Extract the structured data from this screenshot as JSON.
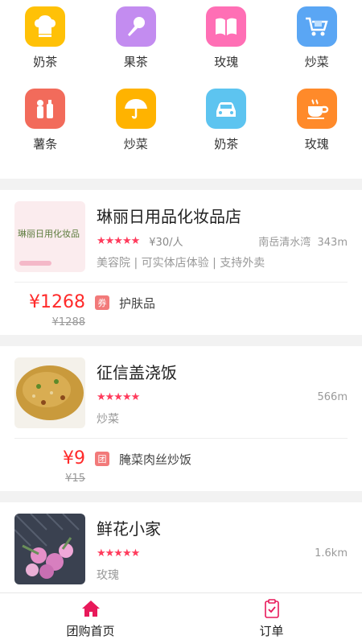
{
  "colors": {
    "accent": "#e8195a",
    "price": "#ff2a2a",
    "star": "#ff3b5c"
  },
  "categories": [
    {
      "label": "奶茶",
      "icon": "chef-hat-icon",
      "color": "#ffc107"
    },
    {
      "label": "果茶",
      "icon": "microphone-icon",
      "color": "#c38cf0"
    },
    {
      "label": "玫瑰",
      "icon": "book-icon",
      "color": "#ff6fb5"
    },
    {
      "label": "炒菜",
      "icon": "shopping-cart-icon",
      "color": "#5aa6f4"
    },
    {
      "label": "薯条",
      "icon": "cosmetics-icon",
      "color": "#f26b5b"
    },
    {
      "label": "炒菜",
      "icon": "umbrella-icon",
      "color": "#ffb300"
    },
    {
      "label": "奶茶",
      "icon": "car-icon",
      "color": "#5dc4f0"
    },
    {
      "label": "玫瑰",
      "icon": "coffee-cup-icon",
      "color": "#ff8a2a"
    }
  ],
  "stores": [
    {
      "name": "琳丽日用品化妆品店",
      "thumb_text": "琳丽日用化妆品",
      "stars": "★★★★★",
      "price_per": "¥30/人",
      "location": "南岳清水湾",
      "distance": "343m",
      "tagline": "美容院 | 可实体店体验 | 支持外卖",
      "deal": {
        "price": "¥1268",
        "original": "¥1288",
        "badge": "券",
        "title": "护肤品"
      }
    },
    {
      "name": "征信盖浇饭",
      "stars": "★★★★★",
      "price_per": "",
      "location": "",
      "distance": "566m",
      "tagline": "炒菜",
      "deal": {
        "price": "¥9",
        "original": "¥15",
        "badge": "团",
        "title": "腌菜肉丝炒饭"
      }
    },
    {
      "name": "鲜花小家",
      "stars": "★★★★★",
      "price_per": "",
      "location": "",
      "distance": "1.6km",
      "tagline": "玫瑰"
    }
  ],
  "tabs": [
    {
      "label": "团购首页",
      "icon": "home-icon",
      "active": true
    },
    {
      "label": "订单",
      "icon": "clipboard-check-icon",
      "active": false
    }
  ]
}
